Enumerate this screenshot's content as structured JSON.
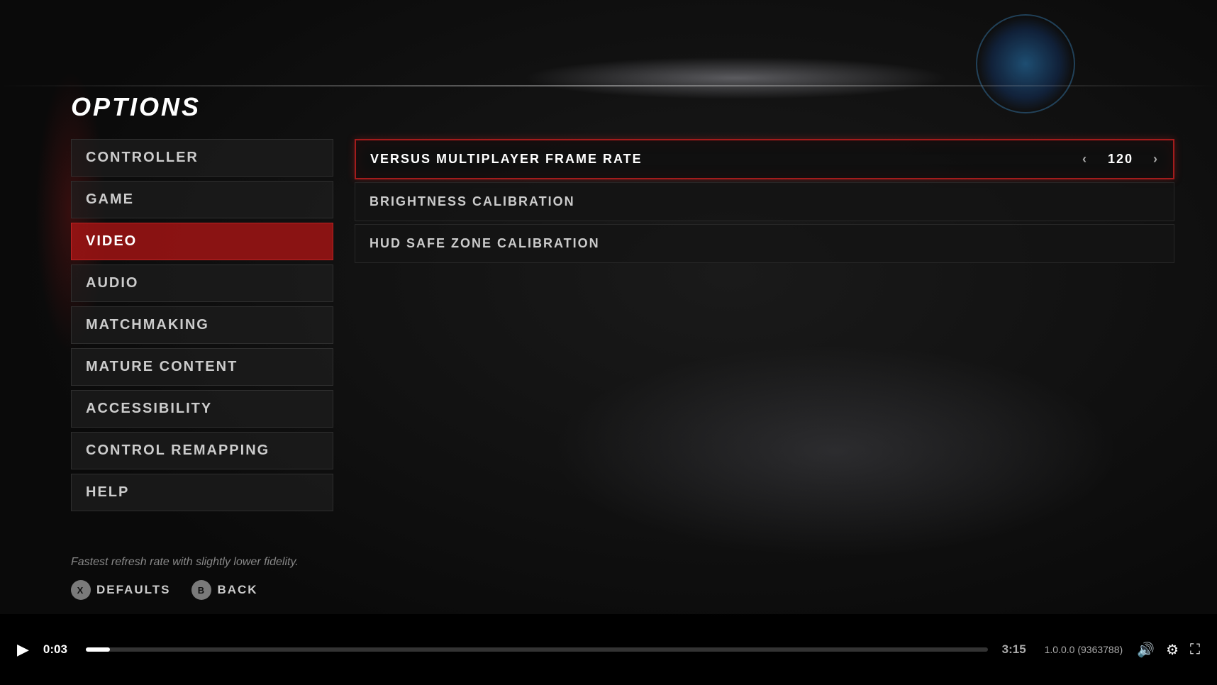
{
  "background": {
    "color": "#0a0a0a"
  },
  "page": {
    "title": "OPTIONS"
  },
  "sidebar": {
    "items": [
      {
        "id": "controller",
        "label": "CONTROLLER",
        "active": false
      },
      {
        "id": "game",
        "label": "GAME",
        "active": false
      },
      {
        "id": "video",
        "label": "VIDEO",
        "active": true
      },
      {
        "id": "audio",
        "label": "AUDIO",
        "active": false
      },
      {
        "id": "matchmaking",
        "label": "MATCHMAKING",
        "active": false
      },
      {
        "id": "mature-content",
        "label": "MATURE CONTENT",
        "active": false
      },
      {
        "id": "accessibility",
        "label": "ACCESSIBILITY",
        "active": false
      },
      {
        "id": "control-remapping",
        "label": "CONTROL REMAPPING",
        "active": false
      },
      {
        "id": "help",
        "label": "HELP",
        "active": false
      }
    ]
  },
  "settings": {
    "items": [
      {
        "id": "versus-multiplayer-frame-rate",
        "label": "VERSUS MULTIPLAYER FRAME RATE",
        "value": "120",
        "selected": true,
        "has_controls": true
      },
      {
        "id": "brightness-calibration",
        "label": "BRIGHTNESS CALIBRATION",
        "value": "",
        "selected": false,
        "has_controls": false
      },
      {
        "id": "hud-safe-zone-calibration",
        "label": "HUD SAFE ZONE CALIBRATION",
        "value": "",
        "selected": false,
        "has_controls": false
      }
    ]
  },
  "footer": {
    "hint": "Fastest refresh rate with slightly lower fidelity.",
    "buttons": [
      {
        "id": "defaults",
        "icon": "X",
        "label": "DEFAULTS"
      },
      {
        "id": "back",
        "icon": "B",
        "label": "BACK"
      }
    ]
  },
  "video_player": {
    "current_time": "0:03",
    "total_time": "3:15",
    "progress_percent": 2.7,
    "version": "1.0.0.0 (9363788)",
    "icons": {
      "volume": "🔊",
      "settings": "⚙",
      "fullscreen": "⛶"
    }
  }
}
